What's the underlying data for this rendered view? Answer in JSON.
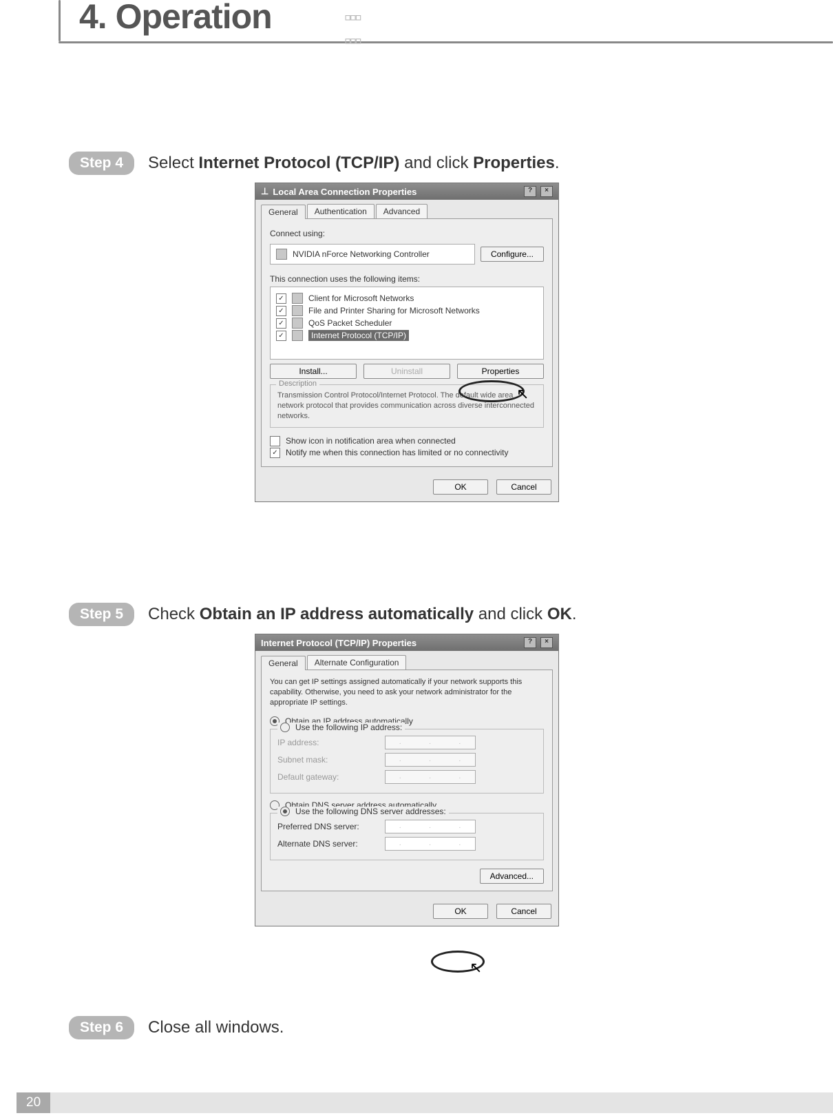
{
  "header": {
    "title": "4. Operation"
  },
  "steps": {
    "s4": {
      "badge": "Step 4",
      "pre": "Select ",
      "b1": "Internet Protocol (TCP/IP)",
      "mid": " and click ",
      "b2": "Properties",
      "post": "."
    },
    "s5": {
      "badge": "Step 5",
      "pre": "Check ",
      "b1": "Obtain an IP address automatically",
      "mid": " and click ",
      "b2": "OK",
      "post": "."
    },
    "s6": {
      "badge": "Step 6",
      "text": "Close all windows."
    }
  },
  "dlg1": {
    "title": "Local Area Connection Properties",
    "tabs": [
      "General",
      "Authentication",
      "Advanced"
    ],
    "connect_label": "Connect using:",
    "adapter": "NVIDIA nForce Networking Controller",
    "configure": "Configure...",
    "uses_label": "This connection uses the following items:",
    "items": [
      "Client for Microsoft Networks",
      "File and Printer Sharing for Microsoft Networks",
      "QoS Packet Scheduler",
      "Internet Protocol (TCP/IP)"
    ],
    "install": "Install...",
    "uninstall": "Uninstall",
    "properties": "Properties",
    "desc_title": "Description",
    "desc": "Transmission Control Protocol/Internet Protocol. The default wide area network protocol that provides communication across diverse interconnected networks.",
    "cb1": "Show icon in notification area when connected",
    "cb2": "Notify me when this connection has limited or no connectivity",
    "ok": "OK",
    "cancel": "Cancel"
  },
  "dlg2": {
    "title": "Internet Protocol (TCP/IP) Properties",
    "tabs": [
      "General",
      "Alternate Configuration"
    ],
    "intro": "You can get IP settings assigned automatically if your network supports this capability. Otherwise, you need to ask your network administrator for the appropriate IP settings.",
    "r1": "Obtain an IP address automatically",
    "r2": "Use the following IP address:",
    "ip": "IP address:",
    "mask": "Subnet mask:",
    "gw": "Default gateway:",
    "r3": "Obtain DNS server address automatically",
    "r4": "Use the following DNS server addresses:",
    "pdns": "Preferred DNS server:",
    "adns": "Alternate DNS server:",
    "advanced": "Advanced...",
    "ok": "OK",
    "cancel": "Cancel"
  },
  "page_number": "20"
}
